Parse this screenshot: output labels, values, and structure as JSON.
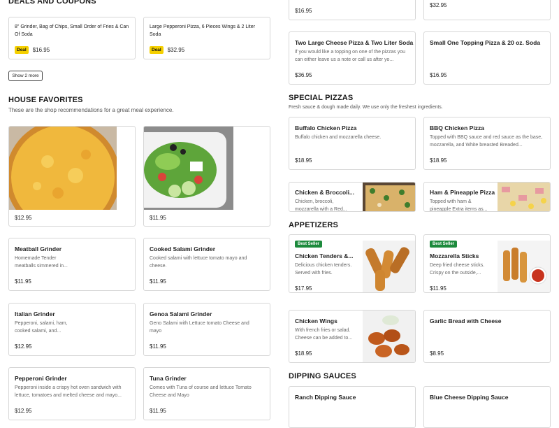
{
  "deals": {
    "title": "DEALS AND COUPONS",
    "items": [
      {
        "desc": "8\" Grinder, Bag of Chips, Small Order of Fries & Can Of Soda",
        "badge": "Deal",
        "price": "$16.95"
      },
      {
        "desc": "Large Pepperoni Pizza, 6 Pieces Wings & 2 Liter Soda",
        "badge": "Deal",
        "price": "$32.95"
      }
    ],
    "show_more": "Show 2 more"
  },
  "house": {
    "title": "HOUSE FAVORITES",
    "subtitle": "These are the shop recommendations for a great meal experience.",
    "photo_prices": [
      "$12.95",
      "$11.95"
    ],
    "items": [
      {
        "name": "Meatball Grinder",
        "desc": "Homemade Tender meatballs simmered in...",
        "price": "$11.95"
      },
      {
        "name": "Cooked Salami Grinder",
        "desc": "Cooked salami with lettuce tomato mayo and cheese.",
        "price": "$11.95"
      },
      {
        "name": "Italian Grinder",
        "desc": "Pepperoni, salami, ham, cooked salami, and...",
        "price": "$12.95"
      },
      {
        "name": "Genoa Salami Grinder",
        "desc": "Geno Salami with Lettuce tomato Cheese and mayo",
        "price": "$11.95"
      },
      {
        "name": "Pepperoni Grinder",
        "desc": "Pepperoni inside a crispy hot oven sandwich with lettuce, tomatoes and melted cheese and mayo...",
        "price": "$12.95"
      },
      {
        "name": "Tuna Grinder",
        "desc": "Comes with Tuna of course and lettuce Tomato Cheese and Mayo",
        "price": "$11.95"
      }
    ]
  },
  "right_top": {
    "prices": [
      "$16.95",
      "$32.95"
    ],
    "items": [
      {
        "name": "Two Large Cheese Pizza & Two Liter Soda",
        "desc": "if you would like a topping on one of the pizzas you can either leave us a note or call us after yo...",
        "price": "$36.95"
      },
      {
        "name": "Small One Topping Pizza & 20 oz. Soda",
        "desc": "",
        "price": "$16.95"
      }
    ]
  },
  "special": {
    "title": "SPECIAL PIZZAS",
    "subtitle": "Fresh sauce & dough made daily. We use only the freshest ingredients.",
    "items": [
      {
        "name": "Buffalo Chicken Pizza",
        "desc": "Buffalo chicken and mozzarella cheese.",
        "price": "$18.95"
      },
      {
        "name": "BBQ Chicken Pizza",
        "desc": "Topped with BBQ sauce and red sauce as the base, mozzarella, and White breasted Breaded...",
        "price": "$18.95"
      },
      {
        "name": "Chicken & Broccoli...",
        "desc": "Chicken, broccoli, mozzarella with a Red...",
        "price": ""
      },
      {
        "name": "Ham & Pineapple Pizza",
        "desc": "Topped with ham & pineapple Extra items as...",
        "price": ""
      }
    ]
  },
  "appetizers": {
    "title": "APPETIZERS",
    "badge": "Best Seller",
    "items": [
      {
        "name": "Chicken Tenders &...",
        "desc": "Delicious chicken tenders. Served with fries.",
        "price": "$17.95"
      },
      {
        "name": "Mozzarella Sticks",
        "desc": "Deep fried cheese sticks. Crispy on the outside,...",
        "price": "$11.95"
      },
      {
        "name": "Chicken Wings",
        "desc": "With french fries or salad. Cheese can be added to...",
        "price": "$18.95"
      },
      {
        "name": "Garlic Bread with Cheese",
        "desc": "",
        "price": "$8.95"
      }
    ]
  },
  "sauces": {
    "title": "DIPPING SAUCES",
    "items": [
      {
        "name": "Ranch Dipping Sauce"
      },
      {
        "name": "Blue Cheese Dipping Sauce"
      }
    ]
  },
  "colors": {
    "deal": "#f5d000",
    "best_seller": "#1c8a3c",
    "border": "#d7d7d7"
  }
}
